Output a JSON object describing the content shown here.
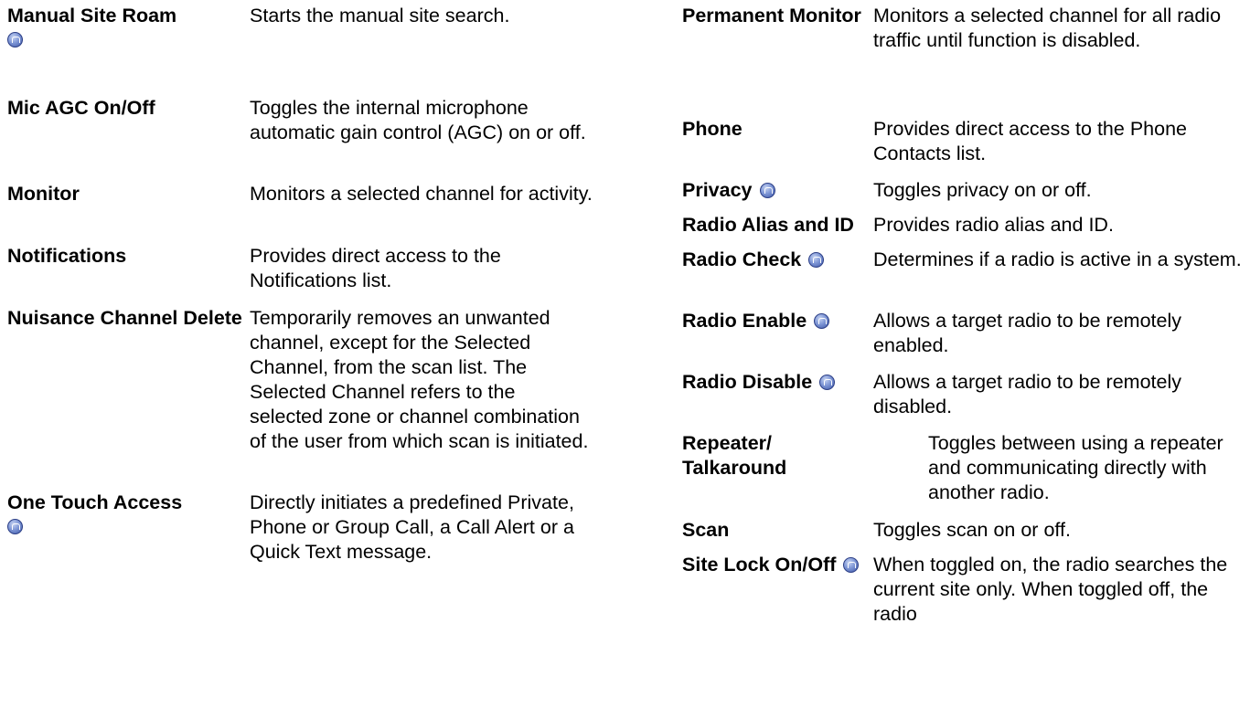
{
  "left_column": [
    {
      "term": "Manual Site Roam",
      "description": "Starts the manual site search."
    },
    {
      "term": "Mic AGC On/Off",
      "description": "Toggles the internal microphone automatic gain control (AGC) on or off."
    },
    {
      "term": "Monitor",
      "description": "Monitors a selected channel for activity."
    },
    {
      "term": "Notifications",
      "description": "Provides direct access to the Notifications list."
    },
    {
      "term": "Nuisance Channel Delete",
      "description": "Temporarily removes an unwanted channel, except for the Selected Channel, from the scan list. The Selected Channel refers to the selected zone or channel combination of the user from which scan is initiated."
    },
    {
      "term": "One Touch Access",
      "description": "Directly initiates a predefined Private, Phone or Group Call, a Call Alert or a Quick Text message."
    }
  ],
  "right_column": [
    {
      "term": "Permanent Monitor",
      "description": "Monitors a selected channel for all radio traffic until function is disabled."
    },
    {
      "term": "Phone",
      "description": "Provides direct access to the Phone Contacts list."
    },
    {
      "term": "Privacy",
      "description": "Toggles privacy on or off."
    },
    {
      "term": "Radio Alias and ID",
      "description": "Provides radio alias and ID."
    },
    {
      "term": "Radio Check",
      "description": "Determines if a radio is active in a system."
    },
    {
      "term": "Radio Enable",
      "description": "Allows a target radio to be remotely enabled."
    },
    {
      "term": "Radio Disable",
      "description": "Allows a target radio to be remotely disabled."
    },
    {
      "term": "Repeater/ Talkaround",
      "description": "Toggles between using a repeater and communicating directly with another radio."
    },
    {
      "term": "Scan",
      "description": "Toggles scan on or off."
    },
    {
      "term": "Site Lock On/Off",
      "description": "When toggled on, the radio searches the current site only. When toggled off, the radio"
    }
  ],
  "icon": "digital-mode-icon"
}
